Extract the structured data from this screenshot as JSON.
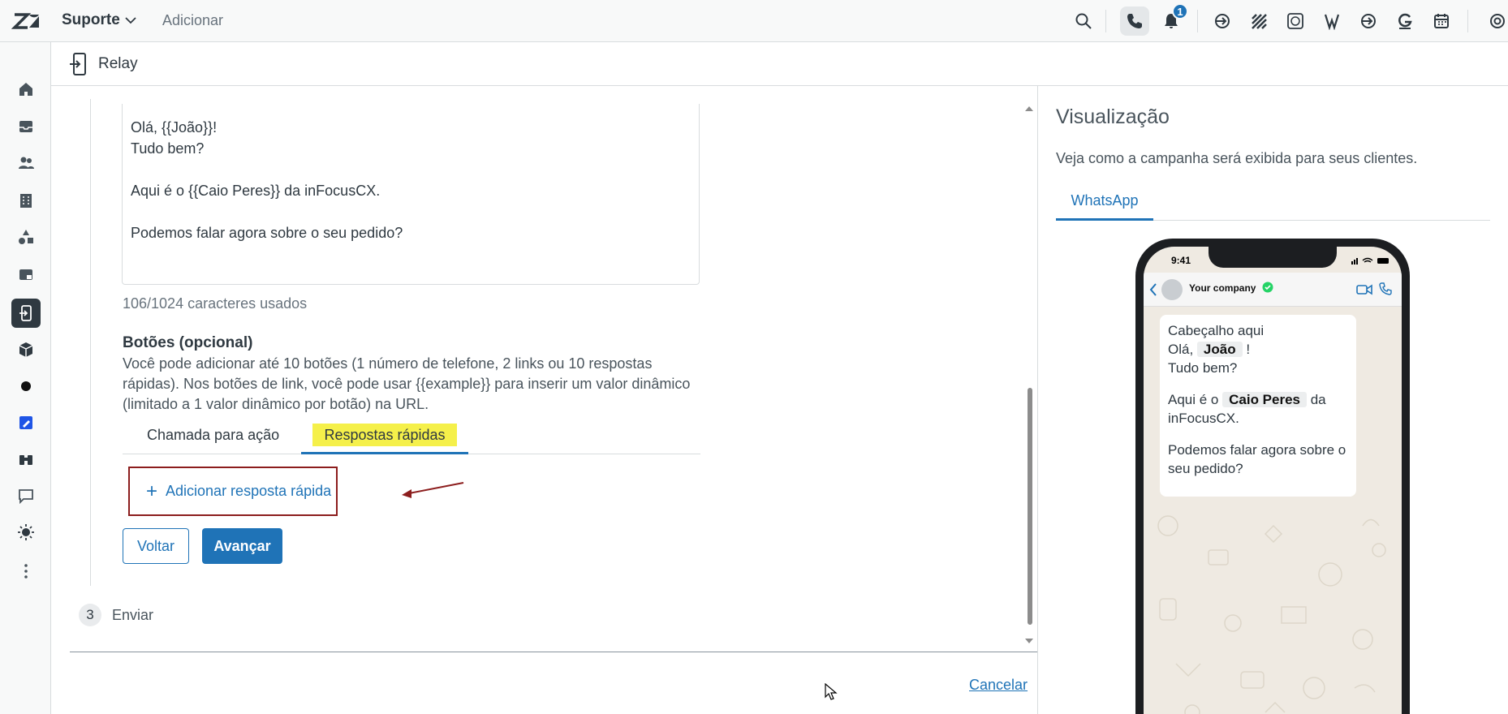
{
  "topbar": {
    "product": "Suporte",
    "add_label": "Adicionar",
    "notification_count": "1"
  },
  "subheader": {
    "title": "Relay"
  },
  "form": {
    "message_lines": "Olá, {{João}}!\nTudo bem?\n\nAqui é o {{Caio Peres}} da inFocusCX.\n\nPodemos falar agora sobre o seu pedido?",
    "char_count": "106/1024 caracteres usados",
    "buttons_title": "Botões (opcional)",
    "buttons_desc": "Você pode adicionar até 10 botões (1 número de telefone, 2 links ou 10 respostas rápidas). Nos botões de link, você pode usar {{example}} para inserir um valor dinâmico (limitado a 1 valor dinâmico por botão) na URL.",
    "tabs": [
      "Chamada para ação",
      "Respostas rápidas"
    ],
    "add_quick_reply": "Adicionar resposta rápida",
    "back_label": "Voltar",
    "next_label": "Avançar",
    "step3_number": "3",
    "step3_label": "Enviar",
    "cancel_label": "Cancelar"
  },
  "preview": {
    "title": "Visualização",
    "subtitle": "Veja como a campanha será exibida para seus clientes.",
    "tab": "WhatsApp",
    "phone": {
      "time": "9:41",
      "contact": "Your company",
      "header_line": "Cabeçalho aqui",
      "greet_prefix": "Olá, ",
      "var_name": "João",
      "greet_suffix": " !",
      "line2": "Tudo bem?",
      "line3_prefix": "Aqui é o ",
      "var_agent": "Caio Peres",
      "line3_suffix": " da inFocusCX.",
      "line4": "Podemos falar agora sobre o seu pedido?"
    }
  },
  "colors": {
    "accent": "#1f73b7",
    "highlight": "#f5f04a",
    "annotation": "#8c1d1d"
  }
}
